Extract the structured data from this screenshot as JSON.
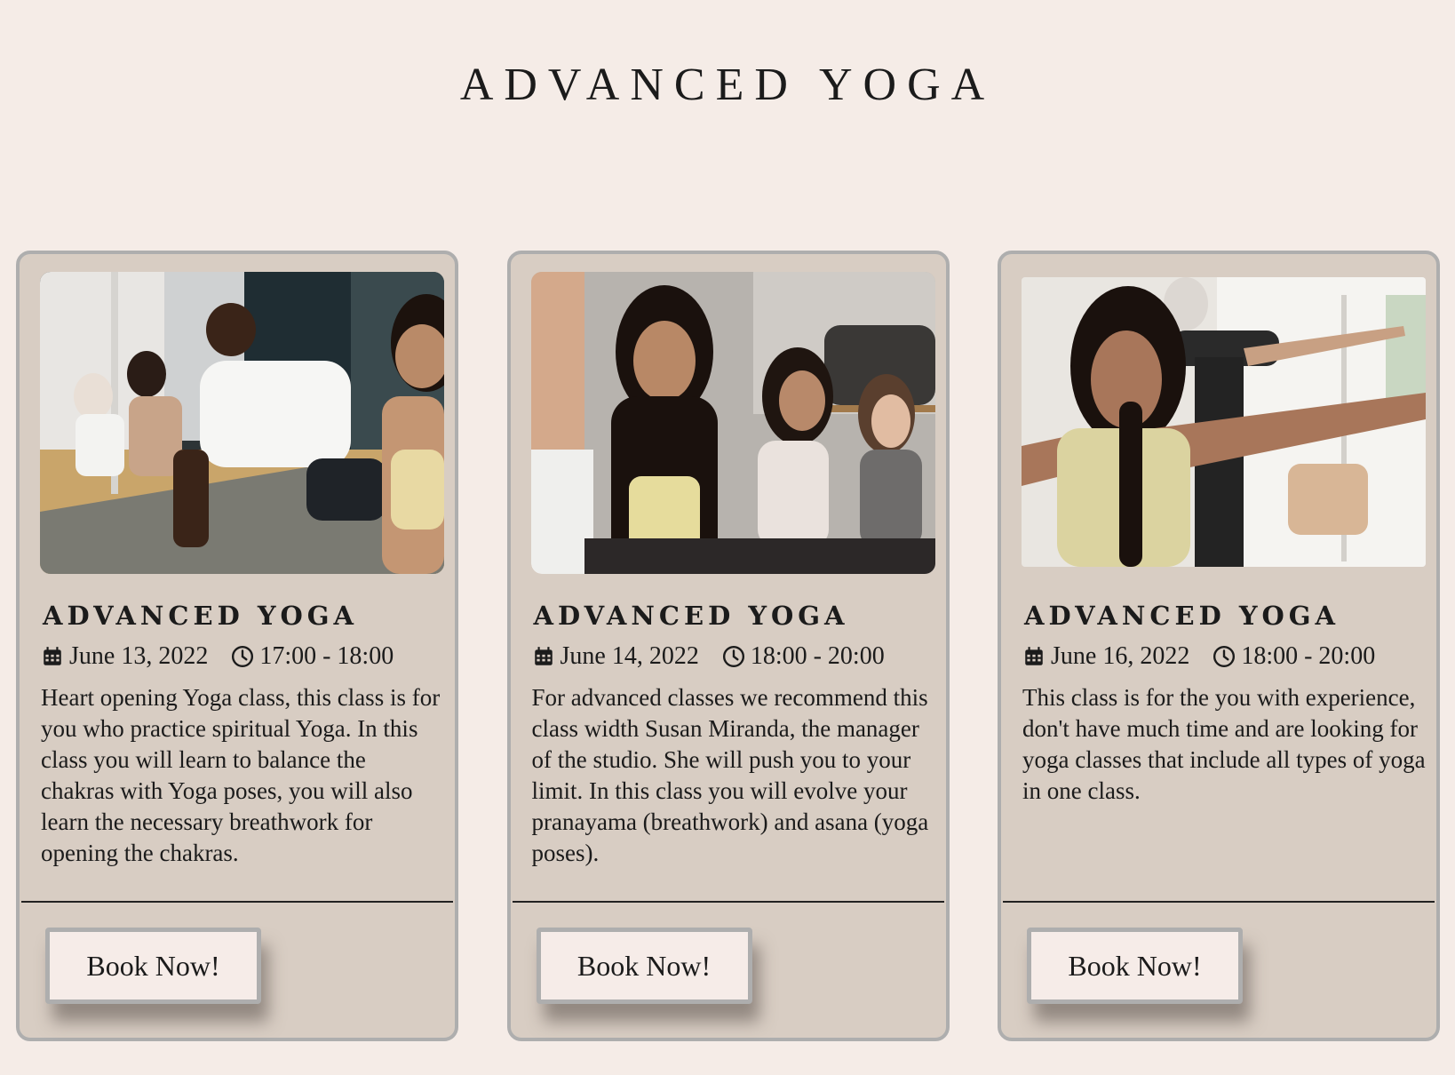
{
  "page": {
    "title": "ADVANCED YOGA"
  },
  "colors": {
    "background": "#f5ece7",
    "card": "#d8cdc3",
    "card_border": "#aeaeae",
    "button_bg": "#f6ece8"
  },
  "cards": [
    {
      "image_icon": "yoga-class-cobra-pose-photo",
      "title": "ADVANCED YOGA",
      "date_icon": "calendar-icon",
      "date": "June 13, 2022",
      "time_icon": "clock-icon",
      "time": "17:00 - 18:00",
      "description": "Heart opening Yoga class, this class is for you who practice spiritual Yoga. In this class you will learn to balance the chakras with Yoga poses, you will also learn the necessary breathwork for opening the chakras.",
      "button_label": "Book Now!"
    },
    {
      "image_icon": "yoga-class-meditation-photo",
      "title": "ADVANCED YOGA",
      "date_icon": "calendar-icon",
      "date": "June 14, 2022",
      "time_icon": "clock-icon",
      "time": "18:00 - 20:00",
      "description": "For advanced classes we recommend this class width Susan Miranda, the manager of the studio. She will push you to your limit. In this class you will evolve your pranayama (breathwork) and asana (yoga poses).",
      "button_label": "Book Now!"
    },
    {
      "image_icon": "yoga-warrior-pose-photo",
      "title": "ADVANCED YOGA",
      "date_icon": "calendar-icon",
      "date": "June 16, 2022",
      "time_icon": "clock-icon",
      "time": "18:00 - 20:00",
      "description": "This class is for the you with experience, don't have much time and are looking for yoga classes that include all types of yoga in one class.",
      "button_label": "Book Now!"
    }
  ]
}
